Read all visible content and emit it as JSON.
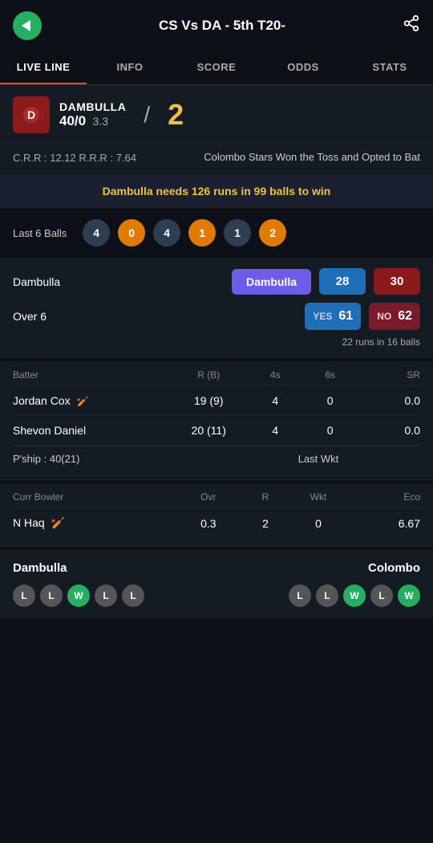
{
  "header": {
    "title": "CS Vs DA - 5th T20-",
    "back_label": "back",
    "share_label": "share"
  },
  "tabs": [
    {
      "label": "LIVE LINE",
      "active": true
    },
    {
      "label": "INFO",
      "active": false
    },
    {
      "label": "SCORE",
      "active": false
    },
    {
      "label": "ODDS",
      "active": false
    },
    {
      "label": "STATS",
      "active": false
    }
  ],
  "match": {
    "team1": {
      "name": "DAMBULLA",
      "logo_emoji": "🏏",
      "score": "40/0",
      "overs": "3.3"
    },
    "innings": "2",
    "crr": "12.12",
    "rrr": "7.64",
    "toss_info": "Colombo Stars Won the Toss and Opted to Bat"
  },
  "alert": {
    "text": "Dambulla needs 126 runs in 99 balls to win"
  },
  "last_balls": {
    "label": "Last 6 Balls",
    "balls": [
      {
        "value": "4",
        "type": "gray"
      },
      {
        "value": "0",
        "type": "orange"
      },
      {
        "value": "4",
        "type": "gray"
      },
      {
        "value": "1",
        "type": "orange"
      },
      {
        "value": "1",
        "type": "gray"
      },
      {
        "value": "2",
        "type": "orange"
      }
    ]
  },
  "betting": {
    "team_label": "Dambulla",
    "team_btn": "Dambulla",
    "score_28": "28",
    "score_30": "30",
    "over_label": "Over  6",
    "yes_label": "YES",
    "yes_val": "61",
    "no_label": "NO",
    "no_val": "62",
    "runs_note": "22 runs in 16 balls"
  },
  "scorecard": {
    "headers": {
      "batter": "Batter",
      "rb": "R (B)",
      "fours": "4s",
      "sixes": "6s",
      "sr": "SR"
    },
    "batters": [
      {
        "name": "Jordan Cox",
        "icon": "🏏",
        "rb": "19 (9)",
        "fours": "4",
        "sixes": "0",
        "sr": "0.0"
      },
      {
        "name": "Shevon Daniel",
        "icon": "",
        "rb": "20 (11)",
        "fours": "4",
        "sixes": "0",
        "sr": "0.0"
      }
    ],
    "partnership": "P'ship : 40(21)",
    "last_wkt": "Last Wkt"
  },
  "bowler": {
    "headers": {
      "curr_bowler": "Curr Bowler",
      "ovr": "Ovr",
      "r": "R",
      "wkt": "Wkt",
      "eco": "Eco"
    },
    "bowlers": [
      {
        "name": "N Haq",
        "icon": "🏏",
        "ovr": "0.3",
        "r": "2",
        "wkt": "0",
        "eco": "6.67"
      }
    ]
  },
  "form": {
    "team1": {
      "name": "Dambulla",
      "results": [
        "L",
        "L",
        "W",
        "L",
        "L"
      ]
    },
    "team2": {
      "name": "Colombo",
      "results": [
        "L",
        "L",
        "W",
        "L",
        "W"
      ]
    }
  }
}
